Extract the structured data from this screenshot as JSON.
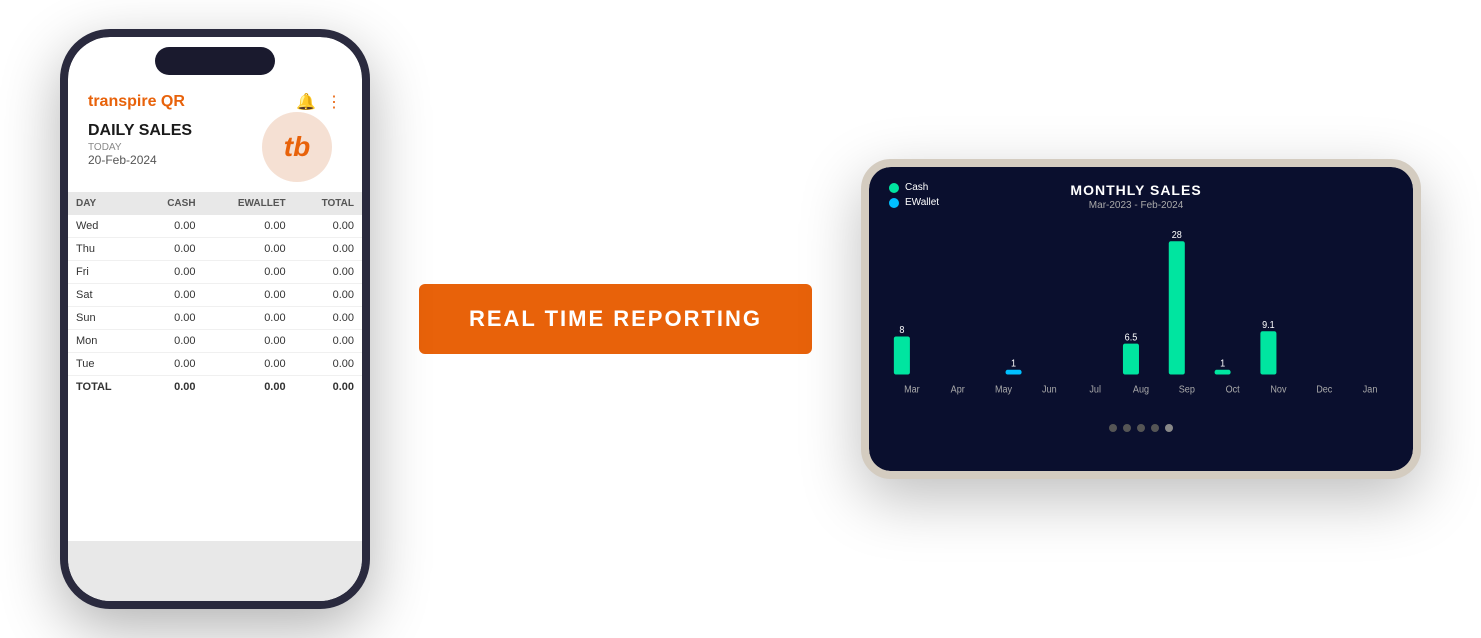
{
  "page": {
    "background": "#ffffff"
  },
  "cta": {
    "label": "REAL TIME REPORTING"
  },
  "phone_left": {
    "app_title": "transpire QR",
    "section_title": "DAILY SALES",
    "today_label": "TODAY",
    "date": "20-Feb-2024",
    "logo_text": "tb",
    "table": {
      "headers": [
        "DAY",
        "CASH",
        "EWALLET",
        "TOTAL"
      ],
      "rows": [
        {
          "day": "Wed",
          "cash": "0.00",
          "ewallet": "0.00",
          "total": "0.00"
        },
        {
          "day": "Thu",
          "cash": "0.00",
          "ewallet": "0.00",
          "total": "0.00"
        },
        {
          "day": "Fri",
          "cash": "0.00",
          "ewallet": "0.00",
          "total": "0.00"
        },
        {
          "day": "Sat",
          "cash": "0.00",
          "ewallet": "0.00",
          "total": "0.00"
        },
        {
          "day": "Sun",
          "cash": "0.00",
          "ewallet": "0.00",
          "total": "0.00"
        },
        {
          "day": "Mon",
          "cash": "0.00",
          "ewallet": "0.00",
          "total": "0.00"
        },
        {
          "day": "Tue",
          "cash": "0.00",
          "ewallet": "0.00",
          "total": "0.00"
        }
      ],
      "total_row": {
        "label": "TOTAL",
        "cash": "0.00",
        "ewallet": "0.00",
        "total": "0.00"
      }
    }
  },
  "phone_right": {
    "legend": {
      "cash_label": "Cash",
      "ewallet_label": "EWallet"
    },
    "chart_title": "MONTHLY SALES",
    "chart_subtitle": "Mar-2023 - Feb-2024",
    "bars": [
      {
        "month": "Mar",
        "cash": 8.0,
        "ewallet": 0
      },
      {
        "month": "Apr",
        "cash": 0,
        "ewallet": 0
      },
      {
        "month": "May",
        "cash": 0,
        "ewallet": 1.0
      },
      {
        "month": "Jun",
        "cash": 0,
        "ewallet": 0
      },
      {
        "month": "Jul",
        "cash": 0,
        "ewallet": 0
      },
      {
        "month": "Aug",
        "cash": 6.5,
        "ewallet": 0
      },
      {
        "month": "Sep",
        "cash": 28.0,
        "ewallet": 0
      },
      {
        "month": "Oct",
        "cash": 1.0,
        "ewallet": 0
      },
      {
        "month": "Nov",
        "cash": 9.1,
        "ewallet": 0
      },
      {
        "month": "Dec",
        "cash": 0,
        "ewallet": 0
      },
      {
        "month": "Jan",
        "cash": 0,
        "ewallet": 0
      }
    ],
    "dots": [
      "inactive",
      "inactive",
      "inactive",
      "inactive",
      "active"
    ]
  }
}
